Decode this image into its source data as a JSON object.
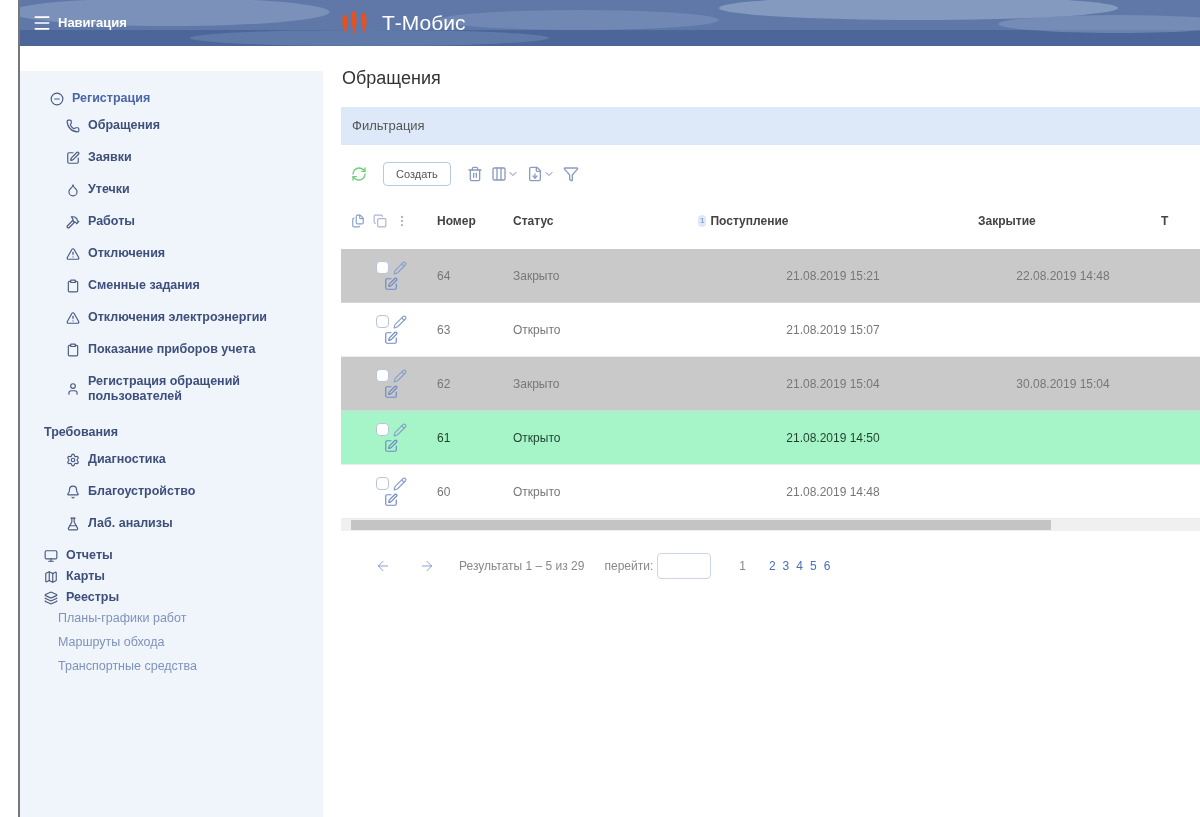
{
  "header": {
    "nav_label": "Навигация",
    "app_title": "Т-Мобис"
  },
  "sidebar": {
    "sections": [
      {
        "label": "Регистрация",
        "children": [
          {
            "label": "Обращения"
          },
          {
            "label": "Заявки"
          },
          {
            "label": "Утечки"
          },
          {
            "label": "Работы"
          },
          {
            "label": "Отключения"
          },
          {
            "label": "Сменные задания"
          },
          {
            "label": "Отключения электроэнергии"
          },
          {
            "label": "Показание приборов учета"
          },
          {
            "label": "Регистрация обращений пользователей"
          }
        ]
      },
      {
        "label": "Требования",
        "children": [
          {
            "label": "Диагностика"
          },
          {
            "label": "Благоустройство"
          },
          {
            "label": "Лаб. анализы"
          }
        ]
      },
      {
        "label": "Отчеты"
      },
      {
        "label": "Карты"
      },
      {
        "label": "Реестры",
        "children": [
          {
            "label": "Планы-графики работ"
          },
          {
            "label": "Маршруты обхода"
          },
          {
            "label": "Транспортные средства"
          }
        ]
      }
    ]
  },
  "page_title": "Обращения",
  "filter_label": "Фильтрация",
  "toolbar": {
    "create_label": "Создать"
  },
  "table": {
    "columns": [
      "Номер",
      "Статус",
      "Поступление",
      "Закрытие",
      "Т"
    ],
    "sort_badge": "1",
    "rows": [
      {
        "kind": "closed",
        "selected": false,
        "cells": [
          "64",
          "Закрыто",
          "21.08.2019 15:21",
          "22.08.2019 14:48"
        ]
      },
      {
        "kind": "open",
        "selected": false,
        "cells": [
          "63",
          "Открыто",
          "21.08.2019 15:07",
          ""
        ]
      },
      {
        "kind": "closed",
        "selected": false,
        "cells": [
          "62",
          "Закрыто",
          "21.08.2019 15:04",
          "30.08.2019 15:04"
        ]
      },
      {
        "kind": "open",
        "selected": true,
        "cells": [
          "61",
          "Открыто",
          "21.08.2019 14:50",
          ""
        ]
      },
      {
        "kind": "open",
        "selected": false,
        "cells": [
          "60",
          "Открыто",
          "21.08.2019 14:48",
          ""
        ]
      }
    ]
  },
  "pagination": {
    "results": "Результаты 1 – 5 из 29",
    "goto_label": "перейти:",
    "pages": [
      {
        "label": "1",
        "selected": true
      },
      {
        "label": "2",
        "selected": false
      },
      {
        "label": "3",
        "selected": false
      },
      {
        "label": "4",
        "selected": false
      },
      {
        "label": "5",
        "selected": false
      },
      {
        "label": "6",
        "selected": false
      }
    ]
  }
}
